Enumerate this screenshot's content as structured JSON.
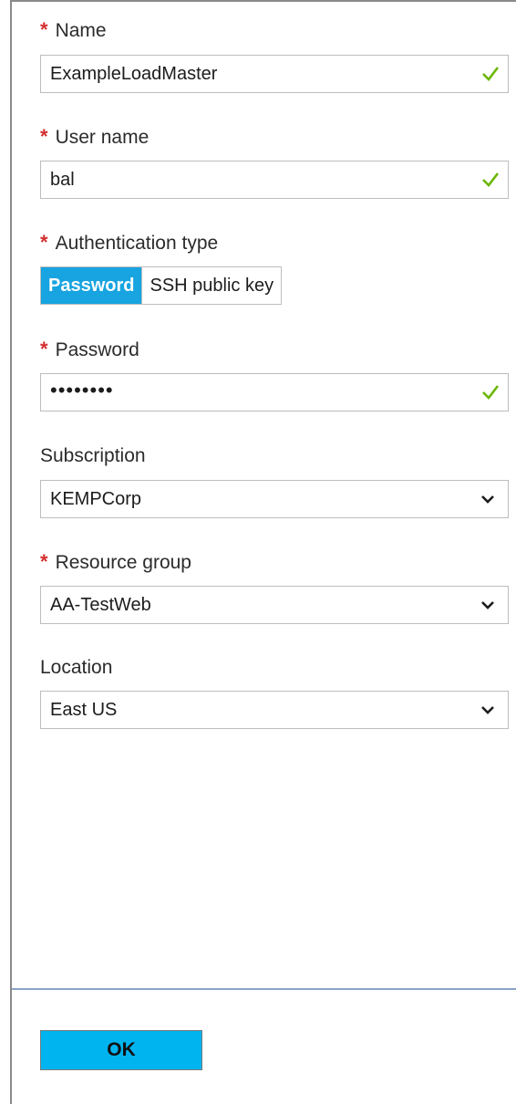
{
  "form": {
    "required_marker": "*",
    "name": {
      "label": "Name",
      "value": "ExampleLoadMaster"
    },
    "user_name": {
      "label": "User name",
      "value": "bal"
    },
    "auth_type": {
      "label": "Authentication type",
      "options": [
        "Password",
        "SSH public key"
      ],
      "selected": "Password"
    },
    "password": {
      "label": "Password",
      "value": "••••••••"
    },
    "subscription": {
      "label": "Subscription",
      "value": "KEMPCorp"
    },
    "resource_group": {
      "label": "Resource group",
      "value": "AA-TestWeb"
    },
    "location": {
      "label": "Location",
      "value": "East US"
    }
  },
  "footer": {
    "ok_label": "OK"
  },
  "colors": {
    "accent": "#17a4e0",
    "ok_button": "#00b4f0",
    "valid_check": "#6bb700",
    "required": "#d32f2f"
  },
  "icons": {
    "valid": "checkmark-icon",
    "dropdown": "chevron-down-icon"
  }
}
